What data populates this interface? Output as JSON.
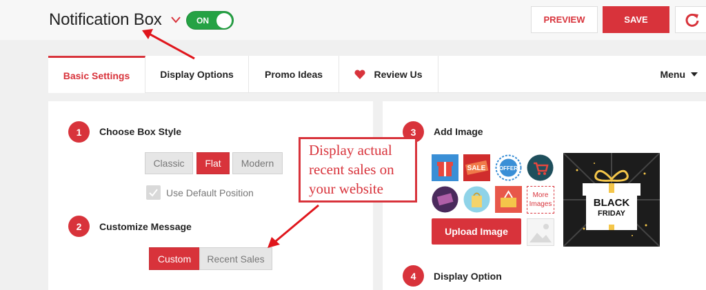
{
  "header": {
    "title": "Notification Box",
    "toggle_label": "ON",
    "preview_label": "PREVIEW",
    "save_label": "SAVE"
  },
  "tabs": [
    {
      "label": "Basic Settings"
    },
    {
      "label": "Display Options"
    },
    {
      "label": "Promo Ideas"
    },
    {
      "label": "Review Us"
    }
  ],
  "menu_label": "Menu",
  "left": {
    "step1": {
      "num": "1",
      "label": "Choose Box Style"
    },
    "styles": [
      "Classic",
      "Flat",
      "Modern"
    ],
    "use_default_position": "Use Default Position",
    "step2": {
      "num": "2",
      "label": "Customize Message"
    },
    "messages": [
      "Custom",
      "Recent Sales"
    ]
  },
  "right": {
    "step3": {
      "num": "3",
      "label": "Add Image"
    },
    "more_images": "More Images",
    "upload_label": "Upload Image",
    "step4": {
      "num": "4",
      "label": "Display Option"
    },
    "promo_image_text": [
      "BLACK",
      "FRIDAY"
    ]
  },
  "callout": {
    "lines": [
      "Display actual",
      "recent sales on",
      "your website"
    ]
  },
  "colors": {
    "accent": "#d8333b",
    "toggle": "#25a244"
  }
}
